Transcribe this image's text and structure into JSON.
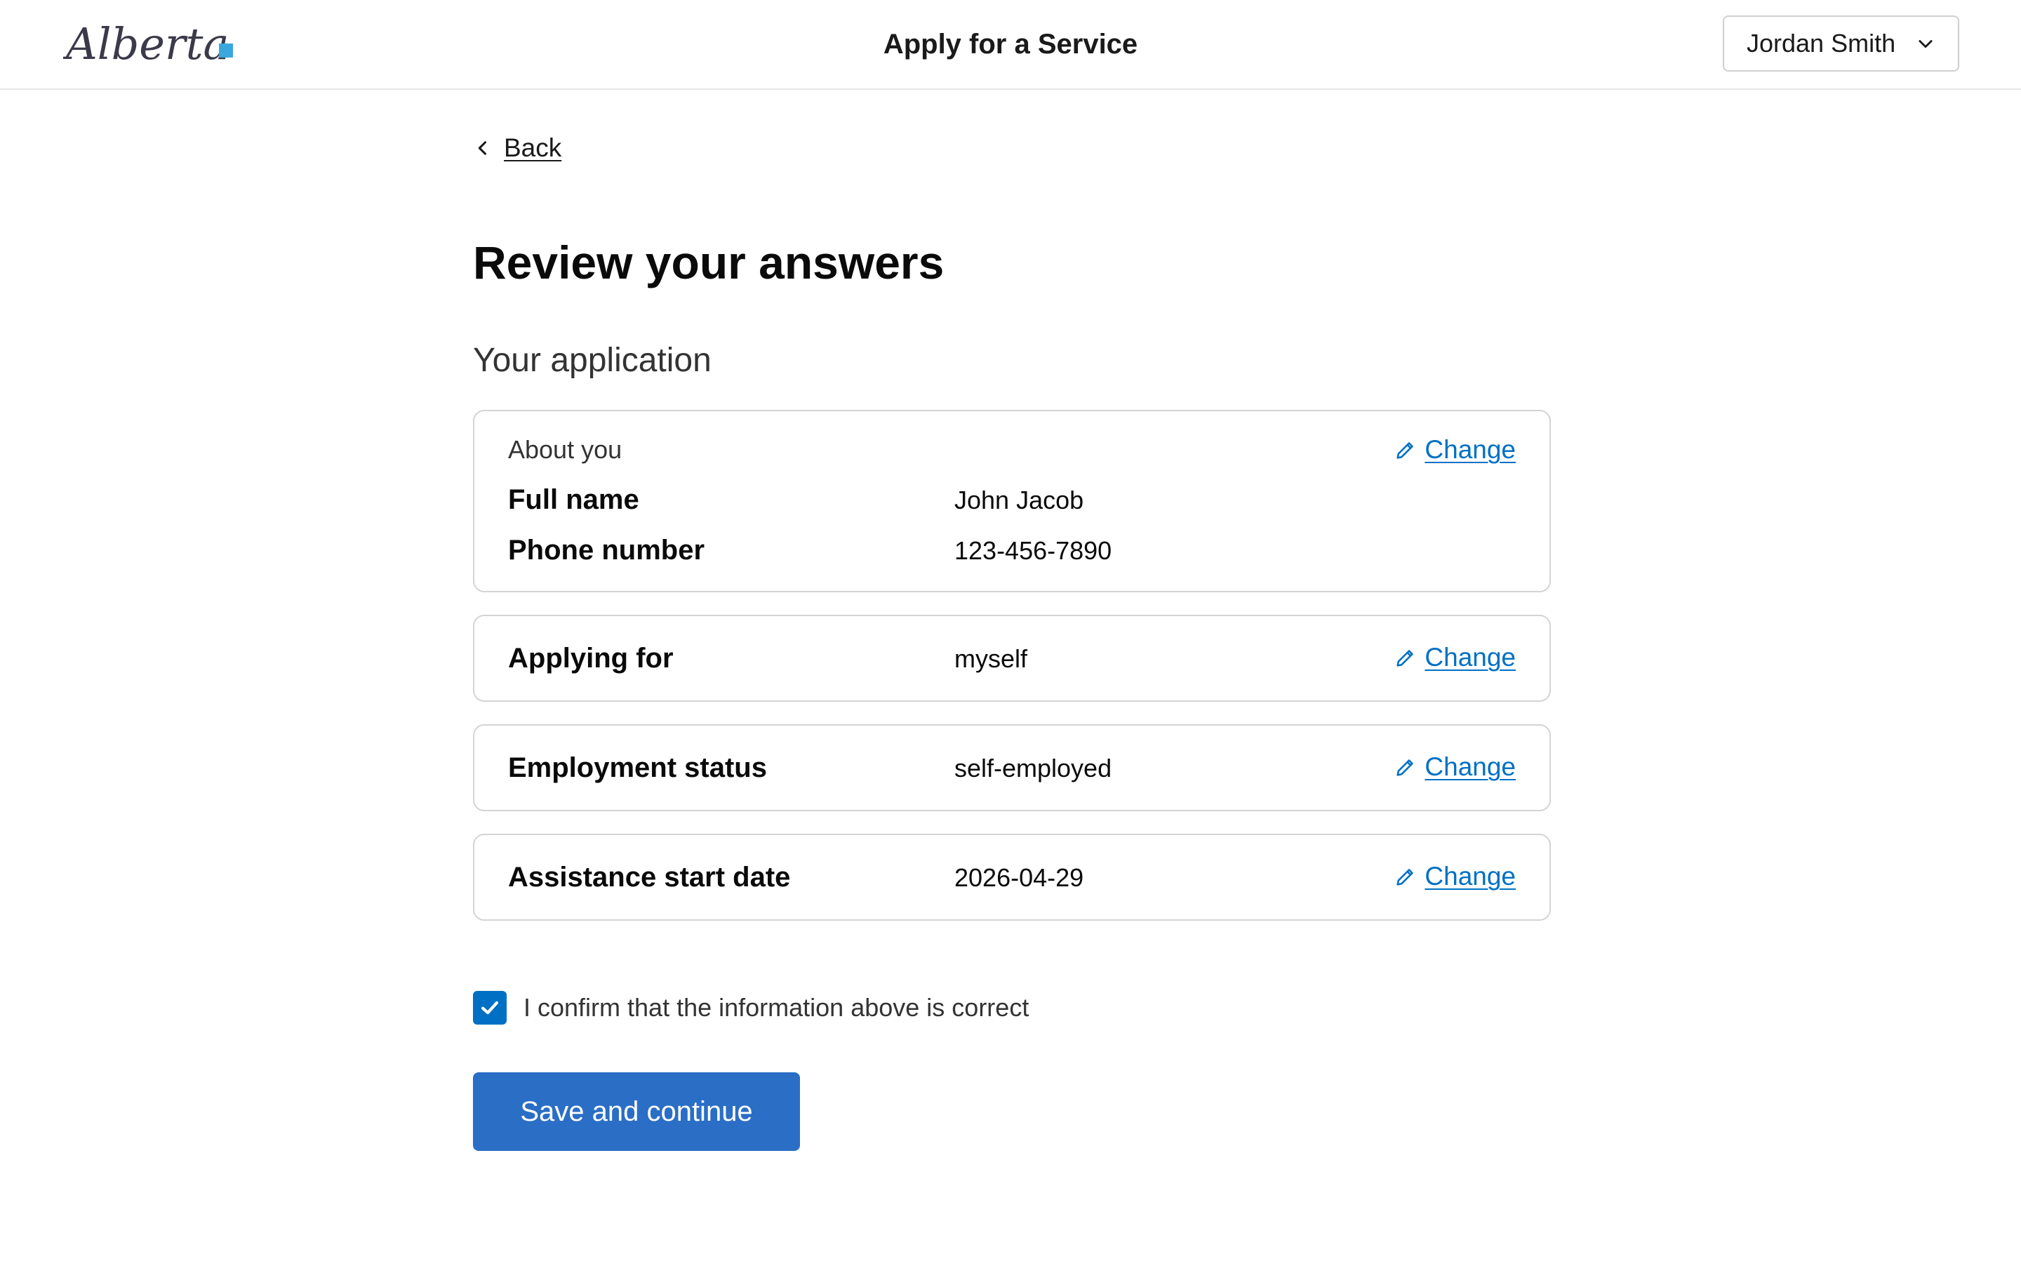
{
  "header": {
    "logo_text": "Alberta",
    "app_title": "Apply for a Service",
    "user_menu": {
      "name": "Jordan Smith",
      "icon": "chevron-down-icon"
    }
  },
  "nav": {
    "back_label": "Back",
    "back_icon": "chevron-left-icon"
  },
  "page": {
    "title": "Review your answers",
    "section_title": "Your application"
  },
  "review": {
    "about_you": {
      "heading": "About you",
      "change_label": "Change",
      "rows": [
        {
          "label": "Full name",
          "value": "John Jacob"
        },
        {
          "label": "Phone number",
          "value": "123-456-7890"
        }
      ]
    },
    "applying_for": {
      "label": "Applying for",
      "value": "myself",
      "change_label": "Change"
    },
    "employment_status": {
      "label": "Employment status",
      "value": "self-employed",
      "change_label": "Change"
    },
    "assistance_start_date": {
      "label": "Assistance start date",
      "value": "2026-04-29",
      "change_label": "Change"
    },
    "change_icon": "pencil-icon"
  },
  "confirm": {
    "checked": true,
    "label": "I confirm that the information above is correct"
  },
  "actions": {
    "save_label": "Save and continue"
  },
  "colors": {
    "primary": "#2a6ec6",
    "link": "#0070c4",
    "border": "#d4d4d4",
    "logo_accent": "#3aa7de"
  }
}
